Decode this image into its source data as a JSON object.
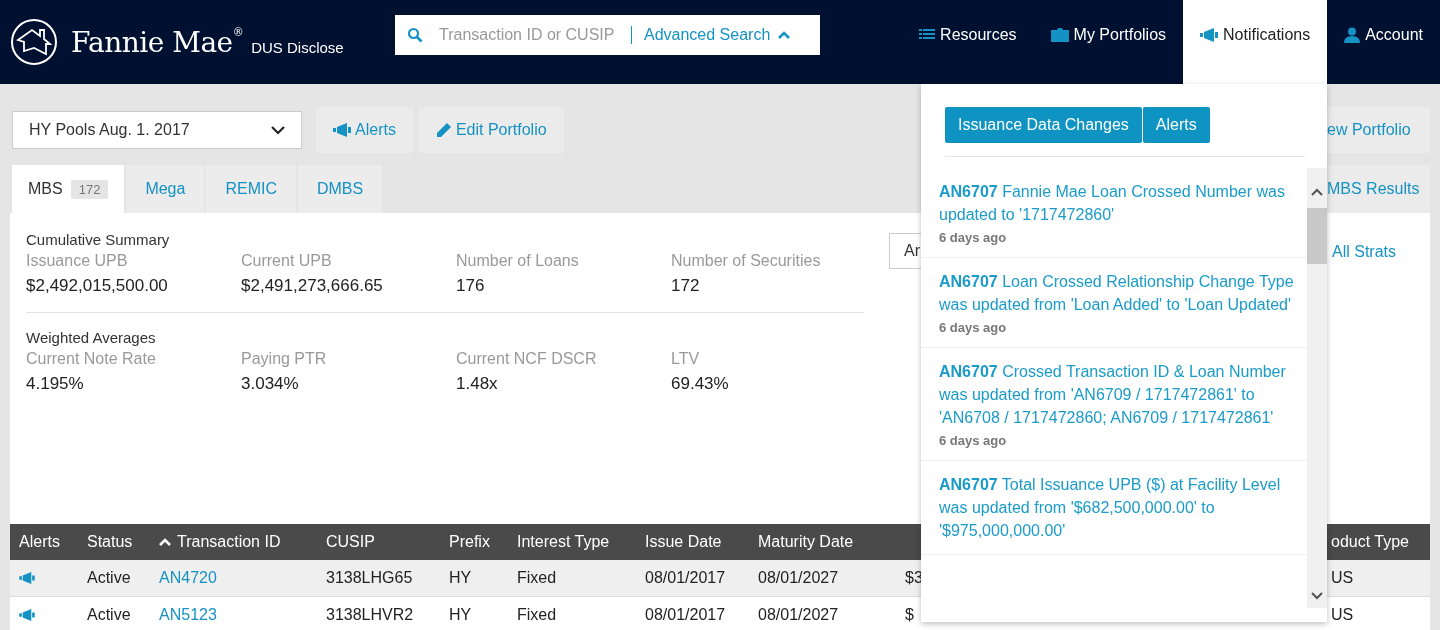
{
  "header": {
    "brand": {
      "name": "Fannie Mae",
      "mark": "®",
      "product": "DUS Disclose"
    },
    "search": {
      "placeholder": "Transaction ID or CUSIP",
      "advanced": "Advanced Search"
    },
    "nav": [
      {
        "label": "Resources",
        "selected": false
      },
      {
        "label": "My Portfolios",
        "selected": false
      },
      {
        "label": "Notifications",
        "selected": true
      },
      {
        "label": "Account",
        "selected": false
      }
    ]
  },
  "toolbar": {
    "portfolio": "HY Pools Aug. 1. 2017",
    "buttons": [
      "Alerts",
      "Edit Portfolio"
    ],
    "right_button": "ew Portfolio"
  },
  "tabs": [
    {
      "label": "MBS",
      "count": "172",
      "selected": true
    },
    {
      "label": "Mega",
      "selected": false
    },
    {
      "label": "REMIC",
      "selected": false
    },
    {
      "label": "DMBS",
      "selected": false
    }
  ],
  "results_button": "MBS Results",
  "summary": [
    {
      "title": "Cumulative Summary",
      "metrics": [
        {
          "label": "Issuance UPB",
          "value": "$2,492,015,500.00"
        },
        {
          "label": "Current UPB",
          "value": "$2,491,273,666.65"
        },
        {
          "label": "Number of Loans",
          "value": "176"
        },
        {
          "label": "Number of Securities",
          "value": "172"
        }
      ]
    },
    {
      "title": "Weighted Averages",
      "metrics": [
        {
          "label": "Current Note Rate",
          "value": "4.195%"
        },
        {
          "label": "Paying PTR",
          "value": "3.034%"
        },
        {
          "label": "Current NCF DSCR",
          "value": "1.48x"
        },
        {
          "label": "LTV",
          "value": "69.43%"
        }
      ]
    }
  ],
  "strat_select": "Ar",
  "strats_link": "All Strats",
  "table": {
    "columns": [
      {
        "label": "Alerts",
        "sorted": false
      },
      {
        "label": "Status",
        "sorted": false
      },
      {
        "label": "Transaction ID",
        "sorted": true
      },
      {
        "label": "CUSIP",
        "sorted": false
      },
      {
        "label": "Prefix",
        "sorted": false
      },
      {
        "label": "Interest Type",
        "sorted": false
      },
      {
        "label": "Issue Date",
        "sorted": false
      },
      {
        "label": "Maturity Date",
        "sorted": false
      },
      {
        "label": "oduct Type",
        "sorted": false
      }
    ],
    "rows": [
      {
        "alert": true,
        "status": "Active",
        "transaction_id": "AN4720",
        "cusip": "3138LHG65",
        "prefix": "HY",
        "interest_type": "Fixed",
        "issue_date": "08/01/2017",
        "maturity_date": "08/01/2027",
        "column_9": "$3",
        "product_type": "US"
      },
      {
        "alert": true,
        "status": "Active",
        "transaction_id": "AN5123",
        "cusip": "3138LHVR2",
        "prefix": "HY",
        "interest_type": "Fixed",
        "issue_date": "08/01/2017",
        "maturity_date": "08/01/2027",
        "column_9": "$",
        "product_type": "US"
      }
    ]
  },
  "notifications": {
    "buttons": [
      "Issuance Data Changes",
      "Alerts"
    ],
    "items": [
      {
        "text": "**AN6707** Fannie Mae Loan Crossed Number was updated to '1717472860'",
        "time": "6 days ago"
      },
      {
        "text": "**AN6707** Loan Crossed Relationship Change Type was updated from 'Loan Added' to 'Loan Updated'",
        "time": "6 days ago"
      },
      {
        "text": "**AN6707** Crossed Transaction ID & Loan Number was updated from 'AN6709 / 1717472861' to 'AN6708 / 1717472860; AN6709 / 1717472861'",
        "time": "6 days ago"
      },
      {
        "text": "**AN6707** Total Issuance UPB ($) at Facility Level was updated from '$682,500,000.00' to '$975,000,000.00'"
      }
    ]
  }
}
